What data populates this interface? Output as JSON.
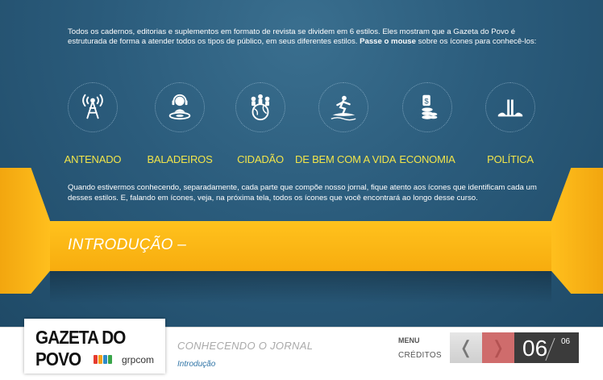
{
  "intro": {
    "text1": "Todos os cadernos, editorias e suplementos em formato de revista se dividem em 6 estilos. Eles mostram que a Gazeta do Povo é estruturada de forma a atender todos os tipos de público, em seus diferentes estilos. ",
    "text_bold": "Passe o mouse",
    "text2": " sobre os ícones para conhecê-los:"
  },
  "styles": [
    {
      "label": "ANTENADO",
      "icon": "antenna-tower-icon"
    },
    {
      "label": "BALADEIROS",
      "icon": "dj-icon"
    },
    {
      "label": "CIDADÃO",
      "icon": "globe-people-icon"
    },
    {
      "label": "DE BEM COM A VIDA",
      "icon": "surfer-icon"
    },
    {
      "label": "ECONOMIA",
      "icon": "money-coins-icon"
    },
    {
      "label": "POLÍTICA",
      "icon": "politics-icon"
    }
  ],
  "bottom_text": "Quando estivermos conhecendo, separadamente, cada parte que compõe nosso jornal, fique atento aos ícones que identificam cada um desses estilos. E, falando em ícones, veja, na próxima tela, todos os ícones que você encontrará ao longo desse curso.",
  "band_title": "INTRODUÇÃO –",
  "footer": {
    "logo_title": "GAZETA DO POVO",
    "logo_sub": "grpcom",
    "course_title": "CONHECENDO O JORNAL",
    "course_sub": "Introdução",
    "menu": "MENU",
    "creditos": "CRÉDITOS",
    "page_current": "06",
    "page_total": "06"
  },
  "colors": {
    "background": "#2b5c7c",
    "accent_yellow": "#f2e54a",
    "band_orange": "#ffbe1a",
    "next_button": "#cf6c6c"
  }
}
